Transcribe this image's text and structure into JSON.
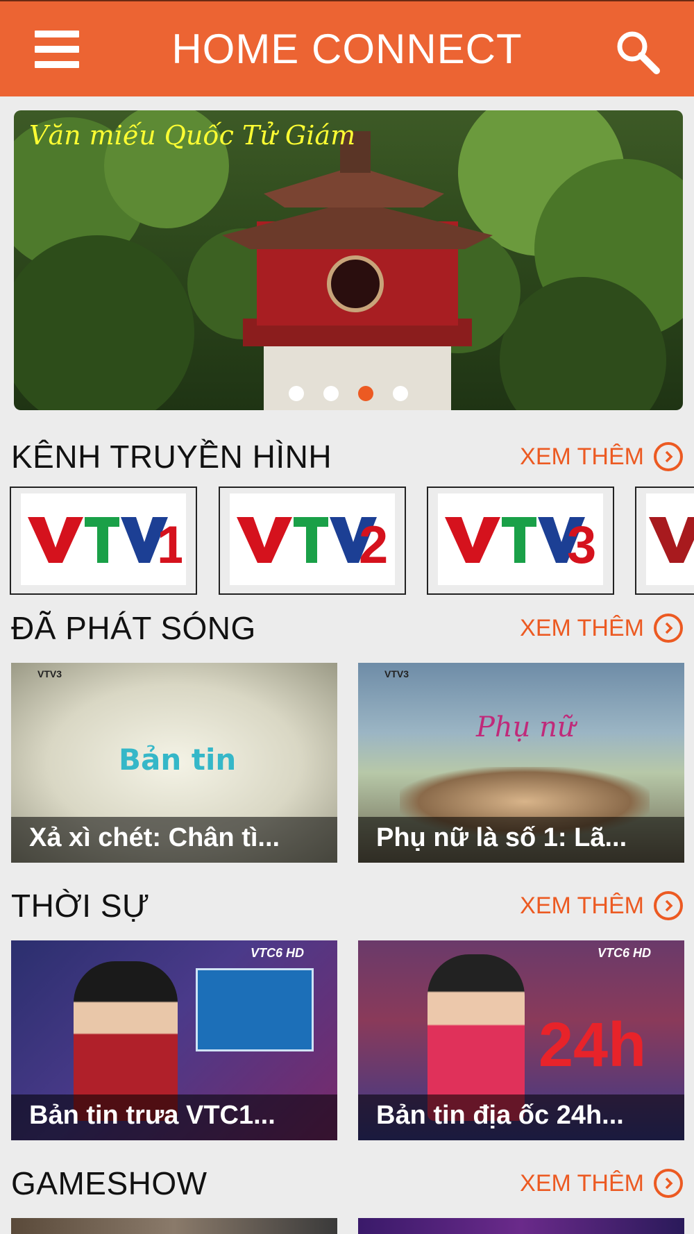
{
  "header": {
    "title": "HOME CONNECT",
    "menu_icon": "hamburger-menu-icon",
    "search_icon": "search-icon",
    "color": "#ec6433"
  },
  "banner": {
    "caption": "Văn miếu Quốc Tử Giám",
    "slides": 4,
    "active_slide": 3
  },
  "channels_section": {
    "title": "KÊNH TRUYỀN HÌNH",
    "more": "XEM THÊM",
    "channels": [
      {
        "name": "VTV1",
        "num": "1"
      },
      {
        "name": "VTV2",
        "num": "2"
      },
      {
        "name": "VTV3",
        "num": "3"
      },
      {
        "name": "VTV",
        "num": ""
      }
    ]
  },
  "aired_section": {
    "title": "ĐÃ PHÁT SÓNG",
    "more": "XEM THÊM",
    "items": [
      {
        "label": "Xả xì chét: Chân tì...",
        "logo": "VTV3"
      },
      {
        "label": "Phụ nữ là số 1:  Lã...",
        "logo": "VTV3"
      }
    ]
  },
  "news_section": {
    "title": "THỜI SỰ",
    "more": "XEM THÊM",
    "items": [
      {
        "label": "Bản tin trưa VTC1...",
        "logo": "VTC6 HD"
      },
      {
        "label": "Bản tin địa ốc 24h...",
        "logo": "VTC6 HD"
      }
    ]
  },
  "gameshow_section": {
    "title": "GAMESHOW",
    "more": "XEM THÊM"
  },
  "accent_color": "#ec5a22"
}
